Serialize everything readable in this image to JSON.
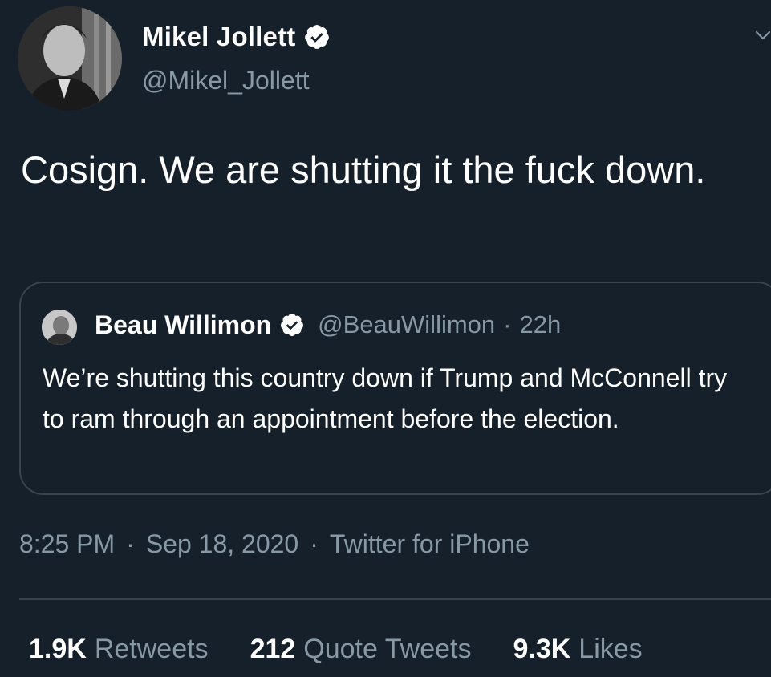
{
  "author": {
    "display_name": "Mikel Jollett",
    "handle": "@Mikel_Jollett",
    "verified": true,
    "avatar_icon": "user-avatar"
  },
  "tweet": {
    "text": "Cosign. We are shutting it the fuck down."
  },
  "quoted_tweet": {
    "display_name": "Beau Willimon",
    "handle": "@BeauWillimon",
    "separator": "·",
    "time": "22h",
    "verified": true,
    "text": "We’re shutting this country down if Trump and McConnell try to ram through an appointment before the election."
  },
  "meta": {
    "time": "8:25 PM",
    "separator": "·",
    "date": "Sep 18, 2020",
    "source": "Twitter for iPhone"
  },
  "stats": {
    "retweets_count": "1.9K",
    "retweets_label": "Retweets",
    "quote_tweets_count": "212",
    "quote_tweets_label": "Quote Tweets",
    "likes_count": "9.3K",
    "likes_label": "Likes"
  },
  "colors": {
    "background": "#15202b",
    "secondary_text": "#8899a6",
    "border": "#38444d",
    "primary_text": "#ffffff"
  }
}
